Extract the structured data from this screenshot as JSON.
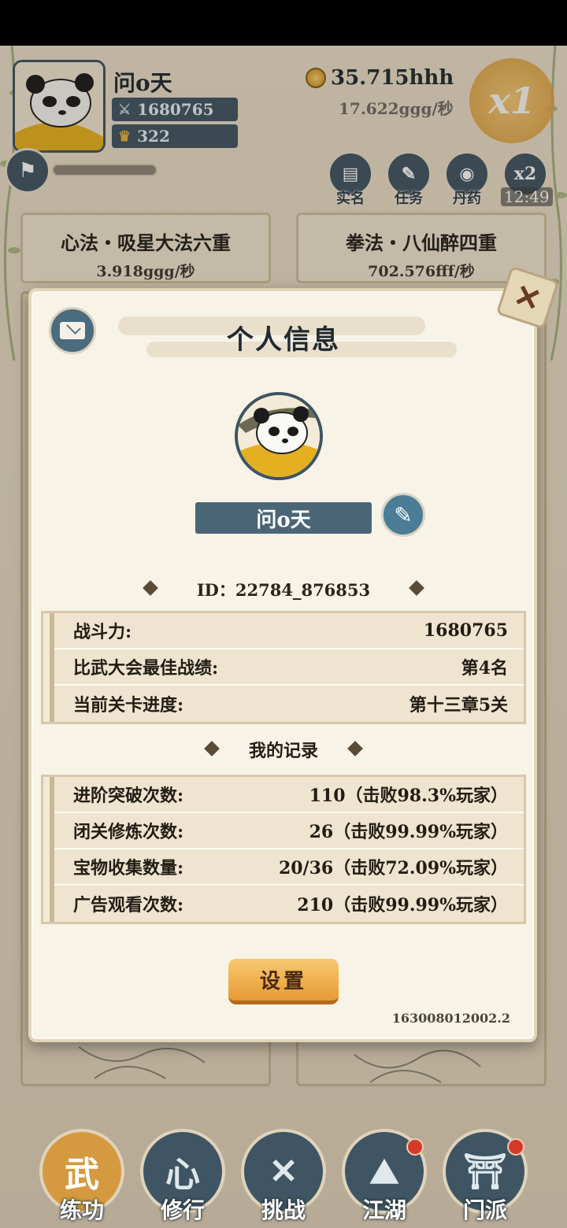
{
  "player": {
    "name": "问o天",
    "power": "1680765",
    "crowns": "322",
    "currency": "35.715hhh",
    "currency_rate": "17.622ggg/秒",
    "multiplier": "x1",
    "speed": "x2",
    "time": "12:49"
  },
  "top_buttons": [
    {
      "label": "实名",
      "icon": "id-card-icon"
    },
    {
      "label": "任务",
      "icon": "scroll-icon"
    },
    {
      "label": "丹药",
      "icon": "gourd-icon"
    }
  ],
  "skills": [
    {
      "title": "心法・吸星大法六重",
      "rate": "3.918ggg/秒"
    },
    {
      "title": "拳法・八仙醉四重",
      "rate": "702.576fff/秒"
    }
  ],
  "modal": {
    "title": "个人信息",
    "name_value": "问o天",
    "id_text": "ID：22784_876853",
    "stats": [
      {
        "label": "战斗力:",
        "value": "1680765"
      },
      {
        "label": "比武大会最佳战绩:",
        "value": "第4名"
      },
      {
        "label": "当前关卡进度:",
        "value": "第十三章5关"
      }
    ],
    "records_title": "我的记录",
    "records": [
      {
        "label": "进阶突破次数:",
        "value": "110（击败98.3%玩家）"
      },
      {
        "label": "闭关修炼次数:",
        "value": "26（击败99.99%玩家）"
      },
      {
        "label": "宝物收集数量:",
        "value": "20/36（击败72.09%玩家）"
      },
      {
        "label": "广告观看次数:",
        "value": "210（击败99.99%玩家）"
      }
    ],
    "settings_label": "设置",
    "version": "163008012002.2"
  },
  "nav": [
    {
      "label": "练功",
      "glyph": "武",
      "active": true,
      "badge": false
    },
    {
      "label": "修行",
      "glyph": "心",
      "active": false,
      "badge": false
    },
    {
      "label": "挑战",
      "glyph": "✕",
      "active": false,
      "badge": false
    },
    {
      "label": "江湖",
      "glyph": "⛰",
      "active": false,
      "badge": true
    },
    {
      "label": "门派",
      "glyph": "⛩",
      "active": false,
      "badge": true
    }
  ],
  "colors": {
    "accent_slate": "#3f5563",
    "gold_button": "#e79a34",
    "badge_red": "#d43a2a",
    "parchment": "#f8f3e7"
  }
}
